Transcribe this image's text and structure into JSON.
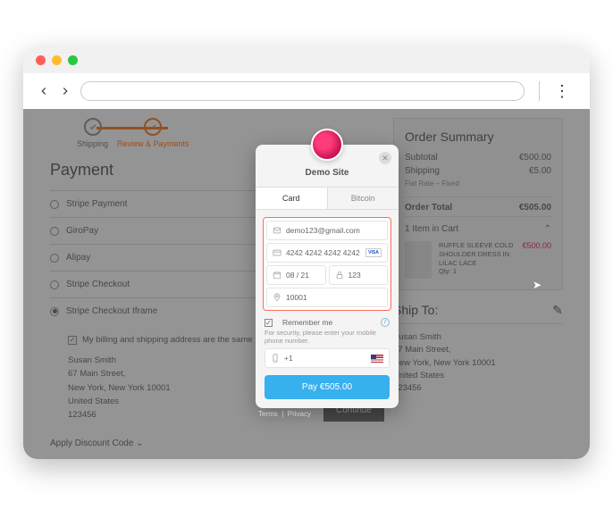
{
  "steps": {
    "shipping": "Shipping",
    "review": "Review & Payments"
  },
  "page_title": "Payment",
  "pay_options": [
    "Stripe Payment",
    "GiroPay",
    "Alipay",
    "Stripe Checkout",
    "Stripe Checkout Iframe"
  ],
  "billing_same": "My billing and shipping address are the same",
  "address": {
    "name": "Susan Smith",
    "street": "67 Main Street,",
    "city": "New York, New York 10001",
    "country": "United States",
    "zip": "123456"
  },
  "continue": "Continue",
  "terms": "Terms",
  "privacy": "Privacy",
  "discount": "Apply Discount Code",
  "order": {
    "title": "Order Summary",
    "subtotal_l": "Subtotal",
    "subtotal_v": "€500.00",
    "shipping_l": "Shipping",
    "shipping_v": "€5.00",
    "rate_note": "Flat Rate – Fixed",
    "total_l": "Order Total",
    "total_v": "€505.00",
    "cart_label": "1 Item in Cart",
    "item_name": "RUFFLE SLEEVE COLD SHOULDER DRESS IN LILAC LACE",
    "item_qty": "Qty: 1",
    "item_price": "€500.00"
  },
  "shipto": {
    "title": "Ship To:",
    "name": "Susan Smith",
    "street": "67 Main Street,",
    "city": "New York, New York 10001",
    "country": "United States",
    "zip": "123456"
  },
  "modal": {
    "site": "Demo Site",
    "tab_card": "Card",
    "tab_bitcoin": "Bitcoin",
    "email": "demo123@gmail.com",
    "card": "4242 4242 4242 4242",
    "exp": "08 / 21",
    "cvc": "123",
    "zip": "10001",
    "remember": "Remember me",
    "sec_note": "For security, please enter your mobile phone number.",
    "phone": "+1",
    "pay_btn": "Pay €505.00"
  }
}
